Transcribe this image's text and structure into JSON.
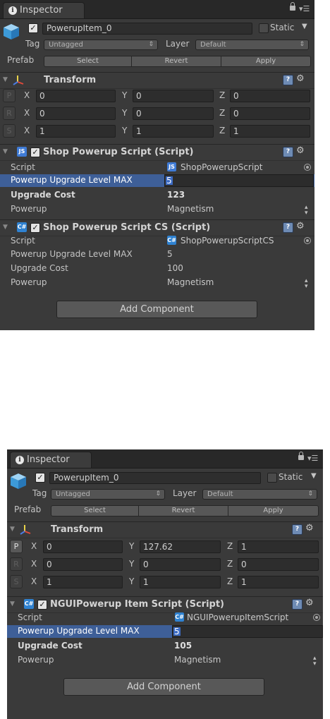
{
  "panel_a": {
    "tab_title": "Inspector",
    "object": {
      "active": true,
      "name": "PowerupItem_0",
      "static_label": "Static",
      "static": false
    },
    "tag_label": "Tag",
    "tag_value": "Untagged",
    "layer_label": "Layer",
    "layer_value": "Default",
    "prefab_label": "Prefab",
    "prefab_select": "Select",
    "prefab_revert": "Revert",
    "prefab_apply": "Apply",
    "transform": {
      "title": "Transform",
      "rows": [
        {
          "tag": "P",
          "x": "0",
          "y": "0",
          "z": "0"
        },
        {
          "tag": "R",
          "x": "0",
          "y": "0",
          "z": "0"
        },
        {
          "tag": "S",
          "x": "1",
          "y": "1",
          "z": "1"
        }
      ]
    },
    "components": [
      {
        "title": "Shop Powerup Script (Script)",
        "icon": "JS",
        "enabled": true,
        "props": [
          {
            "label": "Script",
            "value": "ShopPowerupScript"
          },
          {
            "label": "Powerup Upgrade Level MAX",
            "value": "5"
          },
          {
            "label": "Upgrade Cost",
            "value": "123"
          },
          {
            "label": "Powerup",
            "value": "Magnetism"
          }
        ]
      },
      {
        "title": "Shop Powerup Script CS (Script)",
        "icon": "C#",
        "enabled": true,
        "props": [
          {
            "label": "Script",
            "value": "ShopPowerupScriptCS"
          },
          {
            "label": "Powerup Upgrade Level MAX",
            "value": "5"
          },
          {
            "label": "Upgrade Cost",
            "value": "100"
          },
          {
            "label": "Powerup",
            "value": "Magnetism"
          }
        ]
      }
    ],
    "add_component": "Add Component"
  },
  "panel_b": {
    "tab_title": "Inspector",
    "object": {
      "active": true,
      "name": "PowerupItem_0",
      "static_label": "Static",
      "static": false
    },
    "tag_label": "Tag",
    "tag_value": "Untagged",
    "layer_label": "Layer",
    "layer_value": "Default",
    "prefab_label": "Prefab",
    "prefab_select": "Select",
    "prefab_revert": "Revert",
    "prefab_apply": "Apply",
    "transform": {
      "title": "Transform",
      "rows": [
        {
          "tag": "P",
          "x": "0",
          "y": "127.62",
          "z": "1"
        },
        {
          "tag": "R",
          "x": "0",
          "y": "0",
          "z": "0"
        },
        {
          "tag": "S",
          "x": "1",
          "y": "1",
          "z": "1"
        }
      ]
    },
    "components": [
      {
        "title": "NGUIPowerup Item Script (Script)",
        "icon": "C#",
        "enabled": true,
        "props": [
          {
            "label": "Script",
            "value": "NGUIPowerupItemScript"
          },
          {
            "label": "Powerup Upgrade Level MAX",
            "value": "5"
          },
          {
            "label": "Upgrade Cost",
            "value": "105"
          },
          {
            "label": "Powerup",
            "value": "Magnetism"
          }
        ]
      }
    ],
    "add_component": "Add Component"
  },
  "icons": [
    "info-icon",
    "lock-icon",
    "menu-icon",
    "cube-icon",
    "checkbox-icon",
    "transform-axis-icon",
    "help-icon",
    "gear-icon",
    "js-script-icon",
    "cs-script-icon",
    "target-icon",
    "updown-arrow-icon"
  ],
  "colors": {
    "panel_bg": "#3a3a3a",
    "tab_bar": "#282828",
    "selection": "#3e5f98",
    "field_bg": "#2d2d2d",
    "button_bg": "#585858",
    "script_icon": "#3f7bd6"
  }
}
